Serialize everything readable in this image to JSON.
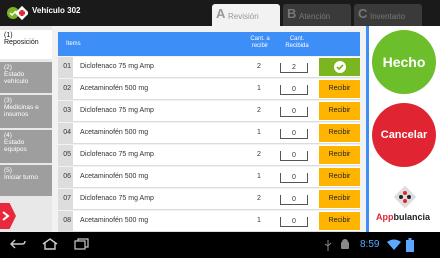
{
  "app": {
    "title": "Vehículo 302"
  },
  "tabs": [
    {
      "letter": "A",
      "label": "Revisión"
    },
    {
      "letter": "B",
      "label": "Atención"
    },
    {
      "letter": "C",
      "label": "Inventario"
    }
  ],
  "steps": [
    {
      "num": "(1)",
      "label": "Reposición"
    },
    {
      "num": "(2)",
      "label": "Estado vehículo"
    },
    {
      "num": "(3)",
      "label": "Medicinas e insumos"
    },
    {
      "num": "(4)",
      "label": "Estado equipos"
    },
    {
      "num": "(5)",
      "label": "Iniciar turno"
    }
  ],
  "table": {
    "headers": {
      "items": "Items",
      "cant_recibir": "Cant. a recibir",
      "cant_recibida": "Cant. Recibida"
    },
    "rows": [
      {
        "idx": "01",
        "name": "Diclofenaco 75 mg Amp",
        "qty": "2",
        "received": "2",
        "action": "",
        "done": true
      },
      {
        "idx": "02",
        "name": "Acetaminofén 500 mg",
        "qty": "1",
        "received": "0",
        "action": "Recibir",
        "done": false
      },
      {
        "idx": "03",
        "name": "Diclofenaco 75 mg Amp",
        "qty": "2",
        "received": "0",
        "action": "Recibir",
        "done": false
      },
      {
        "idx": "04",
        "name": "Acetaminofén 500 mg",
        "qty": "1",
        "received": "0",
        "action": "Recibir",
        "done": false
      },
      {
        "idx": "05",
        "name": "Diclofenaco 75 mg Amp",
        "qty": "2",
        "received": "0",
        "action": "Recibir",
        "done": false
      },
      {
        "idx": "06",
        "name": "Acetaminofén 500 mg",
        "qty": "1",
        "received": "0",
        "action": "Recibir",
        "done": false
      },
      {
        "idx": "07",
        "name": "Diclofenaco 75 mg Amp",
        "qty": "2",
        "received": "0",
        "action": "Recibir",
        "done": false
      },
      {
        "idx": "08",
        "name": "Acetaminofén 500 mg",
        "qty": "1",
        "received": "0",
        "action": "Recibir",
        "done": false
      }
    ]
  },
  "actions": {
    "done": "Hecho",
    "cancel": "Cancelar"
  },
  "brand": {
    "prefix": "App",
    "suffix": "bulancia"
  },
  "status": {
    "time": "8:59"
  },
  "colors": {
    "accent": "#3e8ef7",
    "done": "#6cbf2a",
    "cancel": "#e02431",
    "pending": "#ffb400"
  },
  "icons": [
    "back-icon",
    "home-icon",
    "recent-apps-icon",
    "usb-icon",
    "android-icon",
    "wifi-icon",
    "battery-icon",
    "check-icon",
    "chevron-right-icon"
  ]
}
